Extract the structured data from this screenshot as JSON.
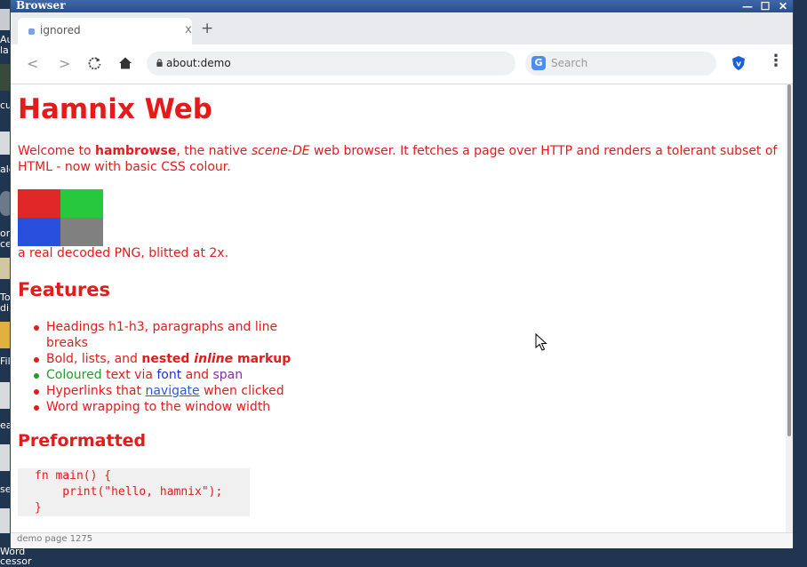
{
  "desktop": {
    "labels": [
      "Au",
      "la",
      "cu",
      "ale",
      "on",
      "ce",
      "To",
      "di",
      "Fil",
      "ea",
      "se",
      "Word",
      "cessor"
    ]
  },
  "window": {
    "title": "Browser",
    "controls": {
      "minimize": "—",
      "maximize": "☐",
      "close": "✕"
    }
  },
  "tabs": [
    {
      "label": "ignored",
      "close": "x"
    }
  ],
  "newtab": "+",
  "toolbar": {
    "back": "<",
    "forward": ">",
    "url": "about:demo",
    "search_badge": "G",
    "search_placeholder": "Search",
    "extension_letter": "v",
    "menu": "⋮"
  },
  "page": {
    "heading": "Hamnix Web",
    "intro": {
      "t1": "Welcome to ",
      "bold": "hambrowse",
      "t2": ", the native ",
      "italic": "scene-DE",
      "t3": " web browser. It fetches a page over HTTP and renders a tolerant subset of HTML - now with basic CSS colour."
    },
    "image_caption": "a real decoded PNG, blitted at 2x.",
    "png_colors": [
      "#e02828",
      "#28c83c",
      "#2850dc",
      "#808080"
    ],
    "features_heading": "Features",
    "features": {
      "f1": "Headings h1-h3, paragraphs and line breaks",
      "f2a": "Bold, lists, and ",
      "f2b": "nested ",
      "f2c": "inline",
      "f2d": " markup",
      "f3a": "Coloured",
      "f3b": " text via ",
      "f3c": "font",
      "f3d": " and ",
      "f3e": "span",
      "f4a": "Hyperlinks that ",
      "f4b": "navigate",
      "f4c": " when clicked",
      "f5": "Word wrapping to the window width"
    },
    "pre_heading": "Preformatted",
    "code": [
      "fn main() {",
      "    print(\"hello, hamnix\");",
      "}"
    ]
  },
  "status": {
    "text": "demo page  1275"
  },
  "colors": {
    "page_text": "#e41b1b",
    "titlebar": "#2c4f8c",
    "green": "#1f9d2a",
    "blue": "#1f2fe0",
    "purple": "#8a2aa8",
    "link": "#2a5bd7"
  }
}
